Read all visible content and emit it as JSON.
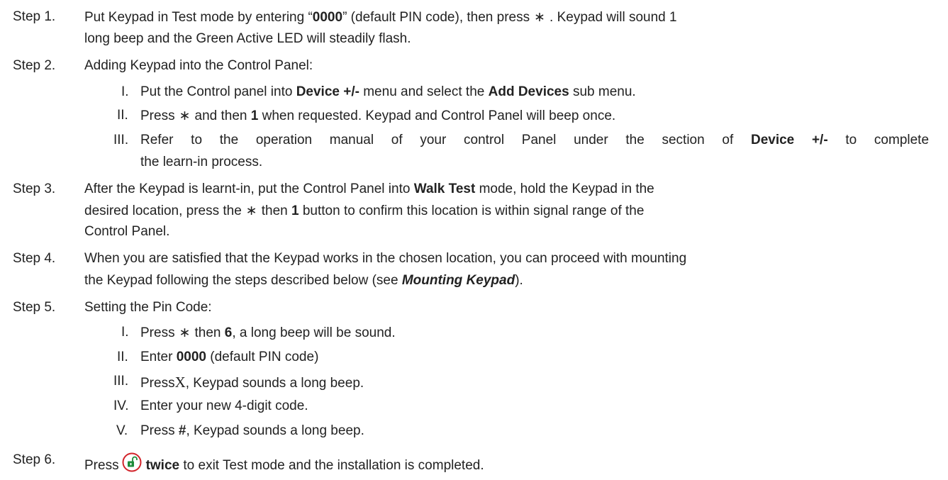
{
  "steps": [
    {
      "label": "Step 1.",
      "lines": [
        {
          "pre": "Put Keypad in Test mode by entering “",
          "b1": "0000",
          "mid": "” (default PIN code), then press",
          "star": "∗",
          "post": ". Keypad will sound 1"
        },
        {
          "text": "long beep and the Green Active LED will steadily flash."
        }
      ]
    },
    {
      "label": "Step 2.",
      "intro": "Adding Keypad into the Control Panel:",
      "items": [
        {
          "num": "I.",
          "pre": "Put the Control panel into ",
          "b1": "Device +/-",
          "mid": " menu and select the ",
          "b2": "Add Devices",
          "post": " sub menu."
        },
        {
          "num": "II.",
          "pre": "Press",
          "star": "∗",
          "mid": "and then ",
          "b1": "1",
          "post": " when requested. Keypad and Control Panel will beep once."
        },
        {
          "num": "III.",
          "pre": "Refer to the operation manual of your control Panel under the section of ",
          "b1": "Device +/-",
          "post": " to complete",
          "cont": "the learn-in process."
        }
      ]
    },
    {
      "label": "Step 3.",
      "line1_pre": "After the Keypad is learnt-in, put the Control Panel into ",
      "line1_b": "Walk Test",
      "line1_post": " mode, hold the Keypad in the",
      "line2_pre": "desired location, press the",
      "star": "∗",
      "line2_mid": "then ",
      "line2_b": "1",
      "line2_post": " button to confirm this location is within signal range of the",
      "line3": "Control Panel."
    },
    {
      "label": "Step 4.",
      "line1": "When you are satisfied that the Keypad works in the chosen location, you can proceed with mounting",
      "line2_pre": "the Keypad following the steps described below (see ",
      "line2_bi": "Mounting Keypad",
      "line2_post": ")."
    },
    {
      "label": "Step 5.",
      "intro": "Setting the Pin Code:",
      "items": [
        {
          "num": "I.",
          "pre": "Press",
          "star": "∗",
          "mid": "then ",
          "b1": "6",
          "post": ", a long beep will be sound."
        },
        {
          "num": "II.",
          "pre": "Enter ",
          "b1": "0000",
          "post": " (default PIN code)"
        },
        {
          "num": "III.",
          "pre": "Press",
          "x": "X",
          "post": ", Keypad sounds a long beep."
        },
        {
          "num": "IV.",
          "text": "Enter your new 4-digit code."
        },
        {
          "num": "V.",
          "pre": "Press ",
          "b1": "#",
          "post": ", Keypad sounds a long beep."
        }
      ]
    },
    {
      "label": "Step 6.",
      "pre": "Press",
      "icon": "unlock-button-icon",
      "b1": "twice",
      "post": " to exit Test mode and the installation is completed."
    }
  ],
  "colors": {
    "text": "#222222",
    "icon_red": "#d2232a",
    "icon_green": "#1f8b3a"
  }
}
